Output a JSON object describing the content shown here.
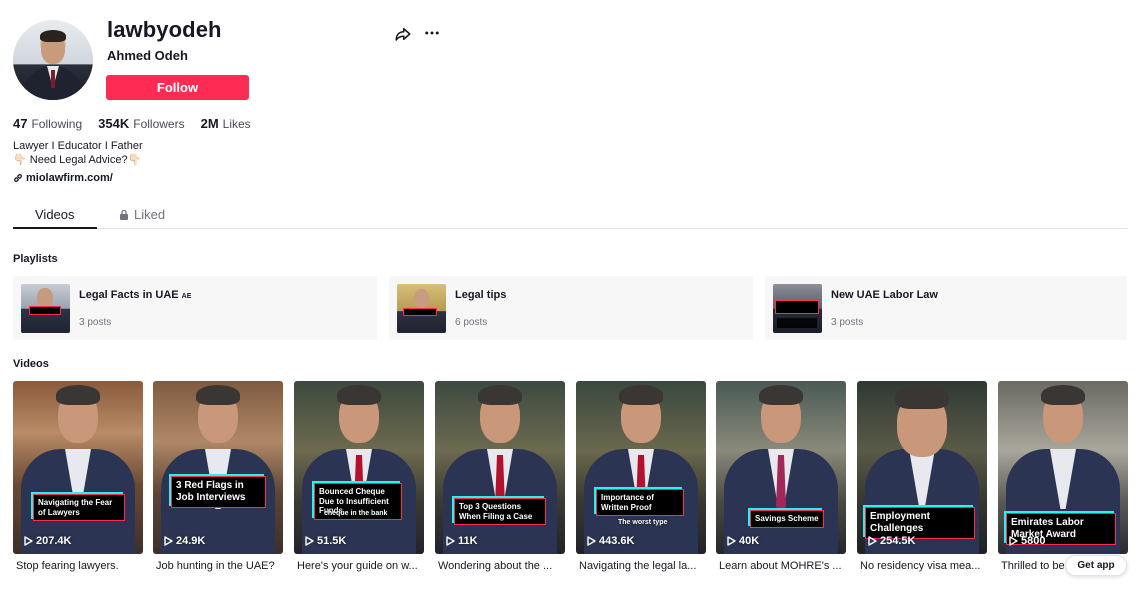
{
  "profile": {
    "username": "lawbyodeh",
    "nickname": "Ahmed Odeh",
    "follow_label": "Follow",
    "stats": [
      {
        "value": "47",
        "label": "Following"
      },
      {
        "value": "354K",
        "label": "Followers"
      },
      {
        "value": "2M",
        "label": "Likes"
      }
    ],
    "bio_line1": "Lawyer I Educator I Father",
    "bio_line2": "👇🏻 Need Legal Advice?👇🏻",
    "link": "miolawfirm.com/"
  },
  "tabs": [
    {
      "label": "Videos",
      "active": true
    },
    {
      "label": "Liked",
      "active": false
    }
  ],
  "playlists_title": "Playlists",
  "playlists": [
    {
      "title": "Legal Facts in UAE",
      "flag": "AE",
      "count": "3 posts"
    },
    {
      "title": "Legal tips",
      "count": "6 posts"
    },
    {
      "title": "New UAE Labor Law",
      "count": "3 posts"
    }
  ],
  "videos_title": "Videos",
  "videos": [
    {
      "caption": "Navigating the Fear of Lawyers",
      "views": "207.4K",
      "desc": "Stop fearing lawyers."
    },
    {
      "caption": "3 Red Flags in Job Interviews",
      "views": "24.9K",
      "desc": "Job hunting in the UAE?"
    },
    {
      "caption": "Bounced Cheque Due to Insufficient Funds",
      "sub": "cheque in the bank",
      "views": "51.5K",
      "desc": "Here's your guide on w..."
    },
    {
      "caption": "Top 3 Questions When Filing a Case",
      "views": "11K",
      "desc": "Wondering about the ..."
    },
    {
      "caption": "Importance of Written Proof",
      "sub": "The worst type",
      "views": "443.6K",
      "desc": "Navigating the legal la..."
    },
    {
      "caption": "Savings Scheme",
      "views": "40K",
      "desc": "Learn about MOHRE's ..."
    },
    {
      "caption": "Employment Challenges",
      "views": "254.5K",
      "desc": "No residency visa mea..."
    },
    {
      "caption": "Emirates Labor Market Award",
      "views": "5800",
      "desc": "Thrilled to be"
    }
  ],
  "get_app_label": "Get app",
  "colors": {
    "accent": "#fe2c55",
    "text": "#161823",
    "muted": "#73747b"
  }
}
